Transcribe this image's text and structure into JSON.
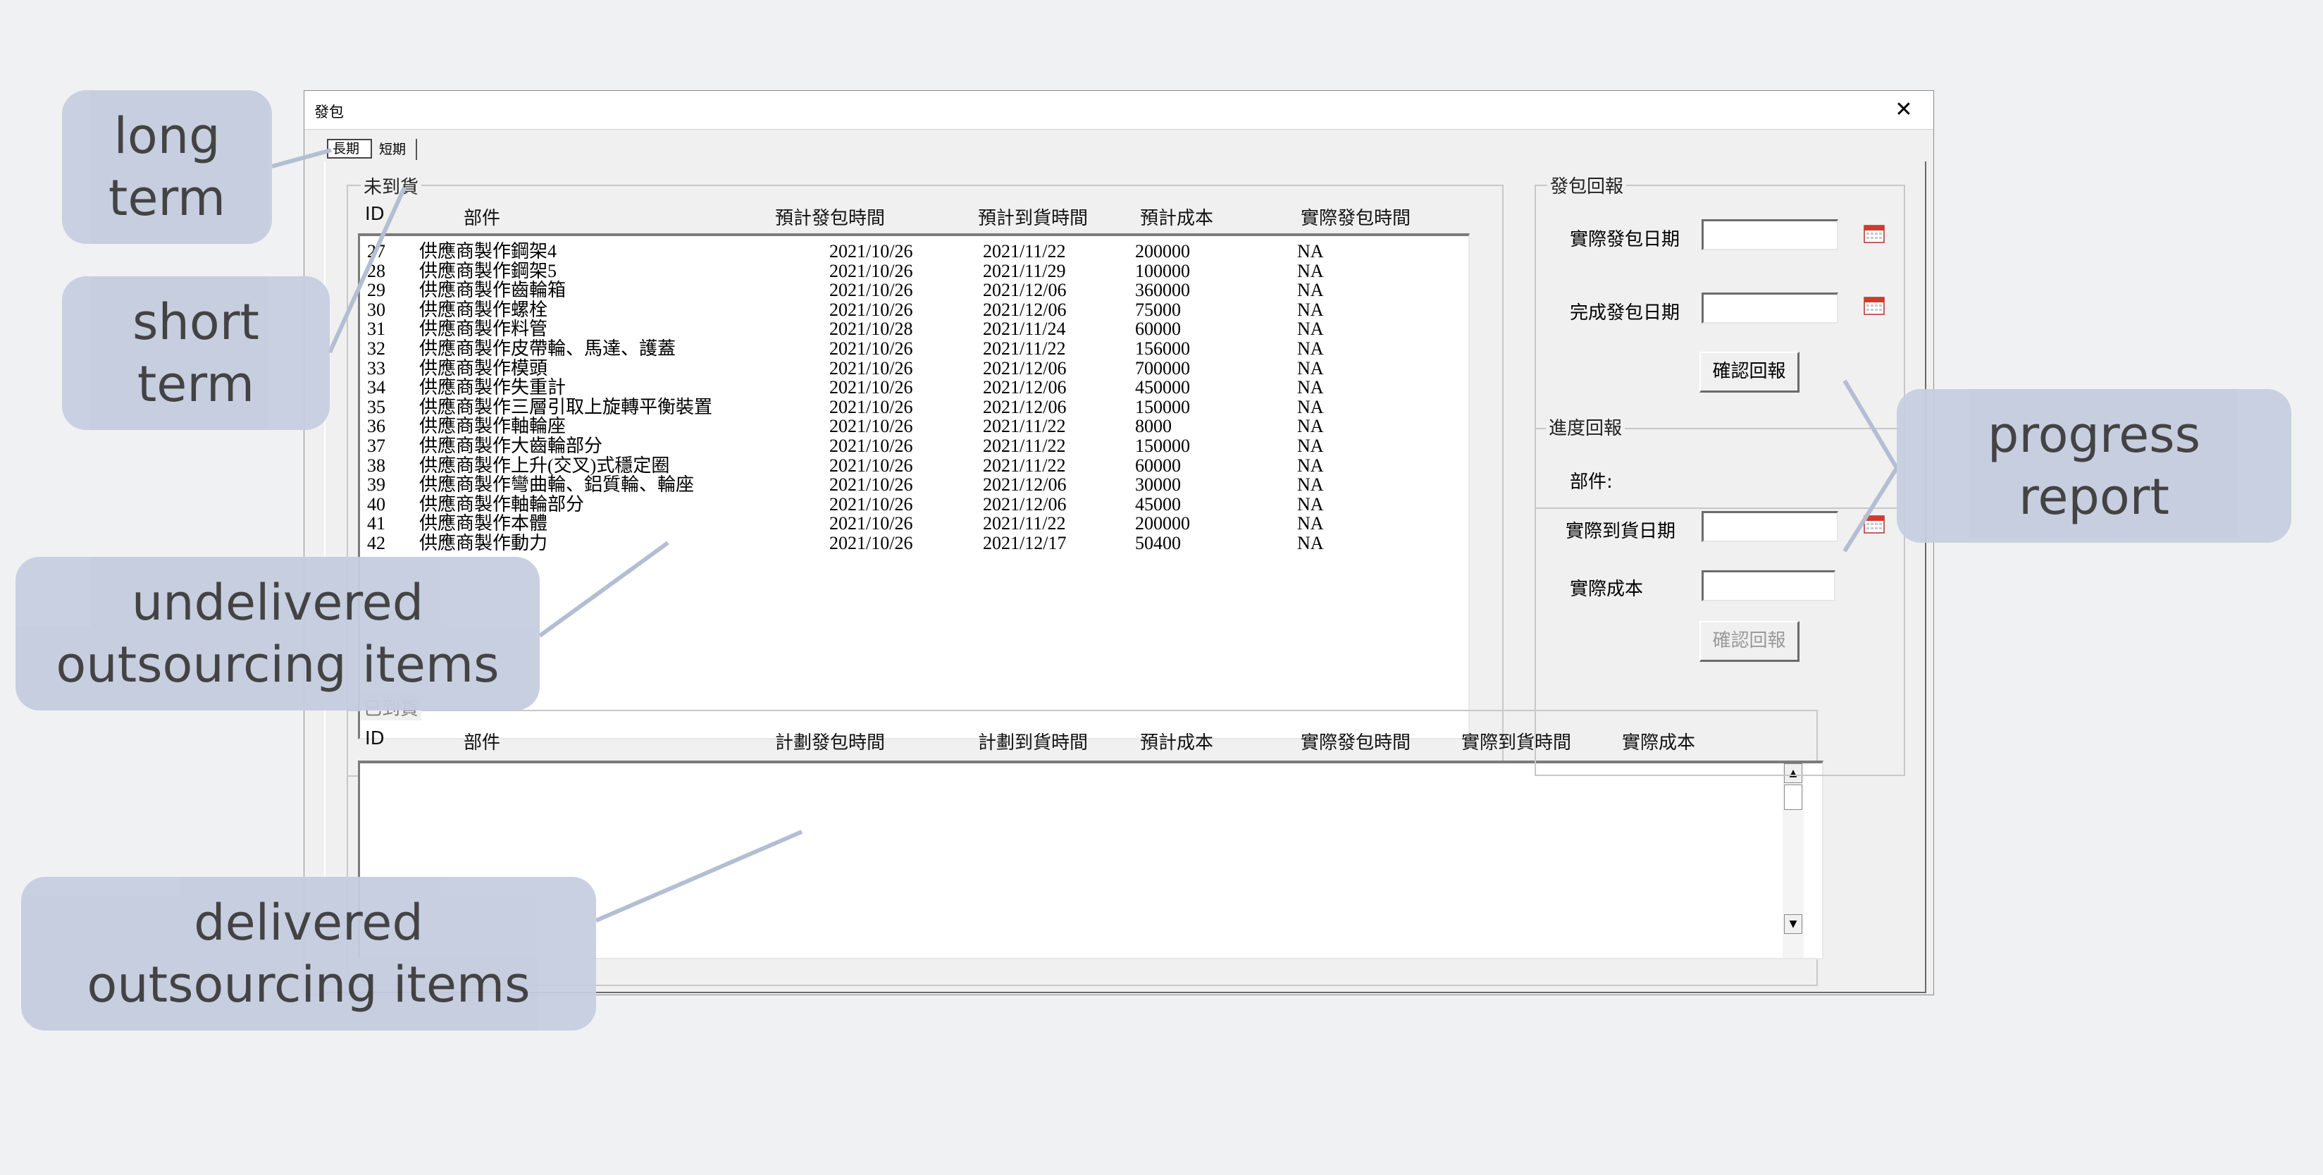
{
  "window": {
    "title": "發包",
    "close_glyph": "✕"
  },
  "tabs": [
    {
      "label": "長期"
    },
    {
      "label": "短期"
    }
  ],
  "undelivered": {
    "group_label": "未到貨",
    "headers": [
      "ID",
      "部件",
      "預計發包時間",
      "預計到貨時間",
      "預計成本",
      "實際發包時間"
    ],
    "rows": [
      [
        "27",
        "供應商製作鋼架4",
        "2021/10/26",
        "2021/11/22",
        "200000",
        "NA"
      ],
      [
        "28",
        "供應商製作鋼架5",
        "2021/10/26",
        "2021/11/29",
        "100000",
        "NA"
      ],
      [
        "29",
        "供應商製作齒輪箱",
        "2021/10/26",
        "2021/12/06",
        "360000",
        "NA"
      ],
      [
        "30",
        "供應商製作螺栓",
        "2021/10/26",
        "2021/12/06",
        "75000",
        "NA"
      ],
      [
        "31",
        "供應商製作料管",
        "2021/10/28",
        "2021/11/24",
        "60000",
        "NA"
      ],
      [
        "32",
        "供應商製作皮帶輪、馬達、護蓋",
        "2021/10/26",
        "2021/11/22",
        "156000",
        "NA"
      ],
      [
        "33",
        "供應商製作模頭",
        "2021/10/26",
        "2021/12/06",
        "700000",
        "NA"
      ],
      [
        "34",
        "供應商製作失重計",
        "2021/10/26",
        "2021/12/06",
        "450000",
        "NA"
      ],
      [
        "35",
        "供應商製作三層引取上旋轉平衡裝置",
        "2021/10/26",
        "2021/12/06",
        "150000",
        "NA"
      ],
      [
        "36",
        "供應商製作軸輪座",
        "2021/10/26",
        "2021/11/22",
        "8000",
        "NA"
      ],
      [
        "37",
        "供應商製作大齒輪部分",
        "2021/10/26",
        "2021/11/22",
        "150000",
        "NA"
      ],
      [
        "38",
        "供應商製作上升(交叉)式穩定圈",
        "2021/10/26",
        "2021/11/22",
        "60000",
        "NA"
      ],
      [
        "39",
        "供應商製作彎曲輪、鋁質輪、輪座",
        "2021/10/26",
        "2021/12/06",
        "30000",
        "NA"
      ],
      [
        "40",
        "供應商製作軸輪部分",
        "2021/10/26",
        "2021/12/06",
        "45000",
        "NA"
      ],
      [
        "41",
        "供應商製作本體",
        "2021/10/26",
        "2021/11/22",
        "200000",
        "NA"
      ],
      [
        "42",
        "供應商製作動力",
        "2021/10/26",
        "2021/12/17",
        "50400",
        "NA"
      ]
    ]
  },
  "delivered": {
    "group_label": "已到貨",
    "headers": [
      "ID",
      "部件",
      "計劃發包時間",
      "計劃到貨時間",
      "預計成本",
      "實際發包時間",
      "實際到貨時間",
      "實際成本"
    ],
    "scroll_up": "▲",
    "scroll_down": "▼"
  },
  "dispatch_report": {
    "group_label": "發包回報",
    "actual_dispatch_label": "實際發包日期",
    "actual_dispatch_value": "",
    "complete_dispatch_label": "完成發包日期",
    "complete_dispatch_value": "",
    "confirm_label": "確認回報"
  },
  "progress_report": {
    "group_label": "進度回報",
    "part_label": "部件:",
    "arrival_label": "實際到貨日期",
    "arrival_value": "",
    "cost_label": "實際成本",
    "cost_value": "",
    "confirm_label": "確認回報"
  },
  "annotations": {
    "long_term": [
      "long",
      "term"
    ],
    "short_term": [
      "short",
      "term"
    ],
    "undelivered": [
      "undelivered",
      "outsourcing items"
    ],
    "delivered": [
      "delivered",
      "outsourcing items"
    ],
    "progress": [
      "progress",
      "report"
    ]
  },
  "icons": {
    "calendar": "calendar-icon",
    "close": "close-icon"
  },
  "colors": {
    "callout_bg": "#c5cde0",
    "callout_line": "#b4bed3",
    "calendar_red": "#d03a2f"
  }
}
